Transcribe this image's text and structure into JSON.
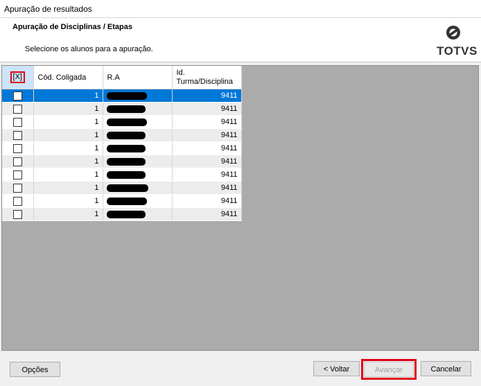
{
  "window": {
    "title": "Apuração de resultados"
  },
  "header": {
    "heading": "Apuração de Disciplinas / Etapas",
    "instruction": "Selecione os alunos para a apuração.",
    "logo_text": "TOTVS"
  },
  "table": {
    "select_all_label": "[X]",
    "columns": [
      "Cód. Coligada",
      "R.A",
      "Id.\nTurma/Disciplina"
    ],
    "rows": [
      {
        "checked": false,
        "coligada": "1",
        "ra": "",
        "turma": "9411",
        "selected": true
      },
      {
        "checked": false,
        "coligada": "1",
        "ra": "",
        "turma": "9411"
      },
      {
        "checked": false,
        "coligada": "1",
        "ra": "",
        "turma": "9411"
      },
      {
        "checked": false,
        "coligada": "1",
        "ra": "",
        "turma": "9411"
      },
      {
        "checked": false,
        "coligada": "1",
        "ra": "",
        "turma": "9411"
      },
      {
        "checked": false,
        "coligada": "1",
        "ra": "",
        "turma": "9411"
      },
      {
        "checked": false,
        "coligada": "1",
        "ra": "",
        "turma": "9411"
      },
      {
        "checked": false,
        "coligada": "1",
        "ra": "",
        "turma": "9411"
      },
      {
        "checked": false,
        "coligada": "1",
        "ra": "",
        "turma": "9411"
      },
      {
        "checked": false,
        "coligada": "1",
        "ra": "",
        "turma": "9411"
      }
    ]
  },
  "buttons": {
    "options": "Opções",
    "back": "< Voltar",
    "next": "Avançar",
    "cancel": "Cancelar"
  },
  "colors": {
    "selection": "#0078d7",
    "highlight": "#e0001a"
  }
}
